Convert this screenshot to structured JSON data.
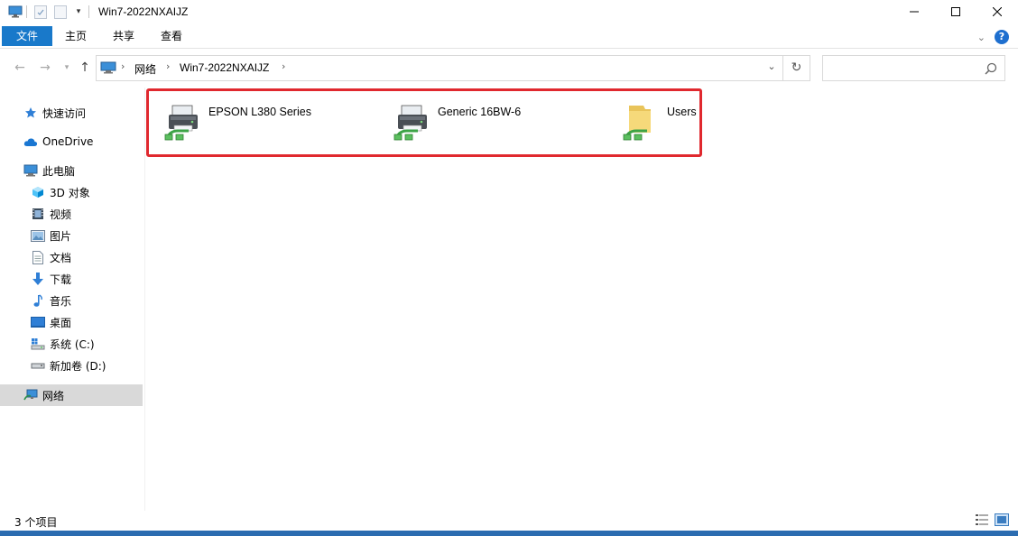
{
  "window": {
    "title": "Win7-2022NXAIJZ"
  },
  "ribbon": {
    "tabs": [
      "文件",
      "主页",
      "共享",
      "查看"
    ]
  },
  "address": {
    "crumbs": [
      "网络",
      "Win7-2022NXAIJZ"
    ]
  },
  "search": {
    "placeholder": "",
    "value": ""
  },
  "sidebar": {
    "items": [
      {
        "label": "快速访问",
        "icon": "star-icon"
      },
      {
        "label": "OneDrive",
        "icon": "cloud-icon"
      },
      {
        "label": "此电脑",
        "icon": "computer-icon"
      },
      {
        "label": "3D 对象",
        "icon": "cube-icon"
      },
      {
        "label": "视频",
        "icon": "film-icon"
      },
      {
        "label": "图片",
        "icon": "picture-icon"
      },
      {
        "label": "文档",
        "icon": "document-icon"
      },
      {
        "label": "下载",
        "icon": "download-arrow-icon"
      },
      {
        "label": "音乐",
        "icon": "music-note-icon"
      },
      {
        "label": "桌面",
        "icon": "desktop-icon"
      },
      {
        "label": "系统 (C:)",
        "icon": "windows-drive-icon"
      },
      {
        "label": "新加卷 (D:)",
        "icon": "drive-icon"
      },
      {
        "label": "网络",
        "icon": "network-icon"
      }
    ],
    "selected": "网络"
  },
  "content": {
    "items": [
      {
        "name": "EPSON L380 Series",
        "icon": "shared-printer-icon"
      },
      {
        "name": "Generic 16BW-6",
        "icon": "shared-printer-icon"
      },
      {
        "name": "Users",
        "icon": "shared-folder-icon"
      }
    ],
    "highlight_color": "#e0282e"
  },
  "status": {
    "count_text": "3 个项目"
  },
  "colors": {
    "accent": "#1979ca",
    "selection": "#d9d9d9"
  }
}
